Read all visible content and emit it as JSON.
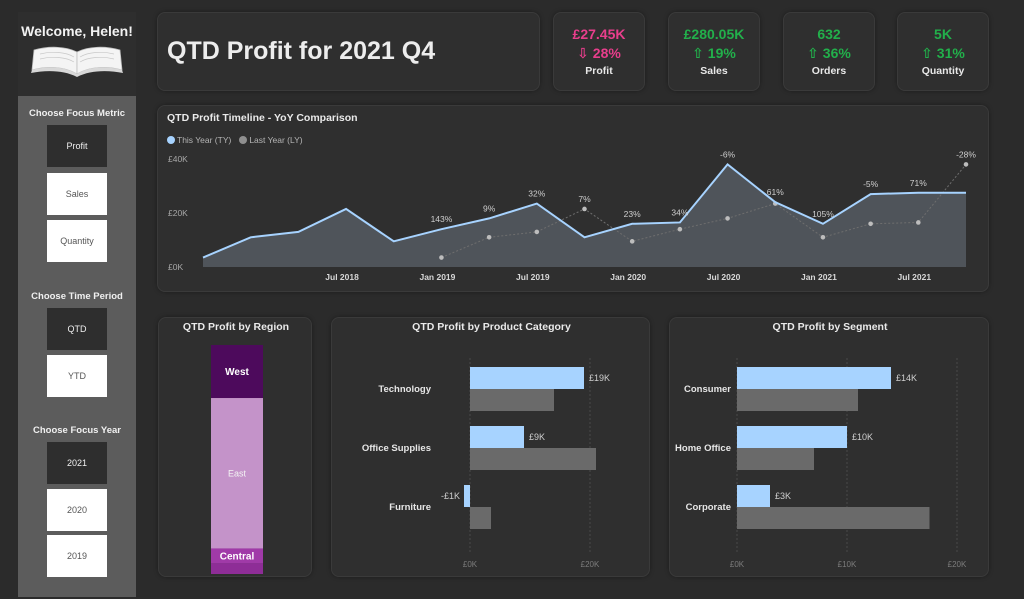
{
  "sidebar": {
    "welcome": "Welcome, Helen!",
    "metric_label": "Choose Focus Metric",
    "metric_options": [
      "Profit",
      "Sales",
      "Quantity"
    ],
    "metric_selected": "Profit",
    "period_label": "Choose Time Period",
    "period_options": [
      "QTD",
      "YTD"
    ],
    "period_selected": "QTD",
    "year_label": "Choose Focus Year",
    "year_options": [
      "2021",
      "2020",
      "2019"
    ],
    "year_selected": "2021"
  },
  "header": {
    "title": "QTD Profit for 2021 Q4"
  },
  "kpis": [
    {
      "value": "£27.45K",
      "change": "⇩ 28%",
      "label": "Profit",
      "color": "#e83e8c"
    },
    {
      "value": "£280.05K",
      "change": "⇧ 19%",
      "label": "Sales",
      "color": "#22b04b"
    },
    {
      "value": "632",
      "change": "⇧ 36%",
      "label": "Orders",
      "color": "#22b04b"
    },
    {
      "value": "5K",
      "change": "⇧ 31%",
      "label": "Quantity",
      "color": "#22b04b"
    }
  ],
  "colors": {
    "this_year": "#a7d3ff",
    "last_year": "#bdbdbd",
    "ly_bar": "#6a6a6a",
    "west": "#4d0a5c",
    "east": "#c493c9",
    "central": "#a03aa8"
  },
  "chart_data": [
    {
      "type": "area",
      "title": "QTD Profit Timeline - YoY Comparison",
      "legend": [
        "This Year (TY)",
        "Last Year (LY)"
      ],
      "legend_position": "top-left",
      "y_ticks": [
        "£0K",
        "£20K",
        "£40K"
      ],
      "x_ticks": [
        "Jul 2018",
        "Jan 2019",
        "Jul 2019",
        "Jan 2020",
        "Jul 2020",
        "Jan 2021",
        "Jul 2021"
      ],
      "ylim": [
        0,
        40
      ],
      "series": [
        {
          "name": "This Year (TY)",
          "x": [
            "2017 Q4",
            "2018 Q1",
            "2018 Q2",
            "2018 Q3",
            "2018 Q4",
            "2019 Q1",
            "2019 Q2",
            "2019 Q3",
            "2019 Q4",
            "2020 Q1",
            "2020 Q2",
            "2020 Q3",
            "2020 Q4",
            "2021 Q1",
            "2021 Q2",
            "2021 Q3",
            "2021 Q4"
          ],
          "values": [
            3.5,
            11,
            13,
            21.5,
            9.5,
            14,
            18,
            23.5,
            11,
            16,
            16.5,
            38,
            24,
            16,
            27,
            27.5,
            27.5
          ]
        },
        {
          "name": "Last Year (LY)",
          "x": [
            "2019 Q1",
            "2019 Q2",
            "2019 Q3",
            "2019 Q4",
            "2020 Q1",
            "2020 Q2",
            "2020 Q3",
            "2020 Q4",
            "2021 Q1",
            "2021 Q2",
            "2021 Q3",
            "2021 Q4"
          ],
          "values": [
            3.5,
            11,
            13,
            21.5,
            9.5,
            14,
            18,
            23.5,
            11,
            16,
            16.5,
            38
          ]
        }
      ],
      "yoy_labels": [
        {
          "x": "2019 Q1",
          "text": "143%"
        },
        {
          "x": "2019 Q2",
          "text": "9%"
        },
        {
          "x": "2019 Q3",
          "text": "32%"
        },
        {
          "x": "2019 Q4",
          "text": "7%"
        },
        {
          "x": "2020 Q1",
          "text": "23%"
        },
        {
          "x": "2020 Q2",
          "text": "34%"
        },
        {
          "x": "2020 Q3",
          "text": "-6%"
        },
        {
          "x": "2020 Q4",
          "text": "61%"
        },
        {
          "x": "2021 Q1",
          "text": "105%"
        },
        {
          "x": "2021 Q2",
          "text": "-5%"
        },
        {
          "x": "2021 Q3",
          "text": "71%"
        },
        {
          "x": "2021 Q4",
          "text": "-28%"
        }
      ]
    },
    {
      "type": "bar",
      "title": "QTD Profit by Region",
      "categories": [
        "West",
        "East",
        "Central"
      ],
      "values": [
        13.5,
        38.3,
        3.8
      ],
      "residual": 2.7
    },
    {
      "type": "bar",
      "title": "QTD Profit by Product Category",
      "categories": [
        "Technology",
        "Office Supplies",
        "Furniture"
      ],
      "series": [
        {
          "name": "This Year (TY)",
          "values": [
            19,
            9,
            -1
          ]
        },
        {
          "name": "Last Year (LY)",
          "values": [
            14,
            21,
            3.5
          ]
        }
      ],
      "data_labels": [
        "£19K",
        "£9K",
        "-£1K"
      ],
      "x_ticks": [
        "£0K",
        "£20K"
      ],
      "xlim": [
        0,
        25
      ]
    },
    {
      "type": "bar",
      "title": "QTD Profit by Segment",
      "categories": [
        "Consumer",
        "Home Office",
        "Corporate"
      ],
      "series": [
        {
          "name": "This Year (TY)",
          "values": [
            14,
            10,
            3
          ]
        },
        {
          "name": "Last Year (LY)",
          "values": [
            11,
            7,
            17.5
          ]
        }
      ],
      "data_labels": [
        "£14K",
        "£10K",
        "£3K"
      ],
      "x_ticks": [
        "£0K",
        "£10K",
        "£20K"
      ],
      "xlim": [
        0,
        20
      ]
    }
  ]
}
